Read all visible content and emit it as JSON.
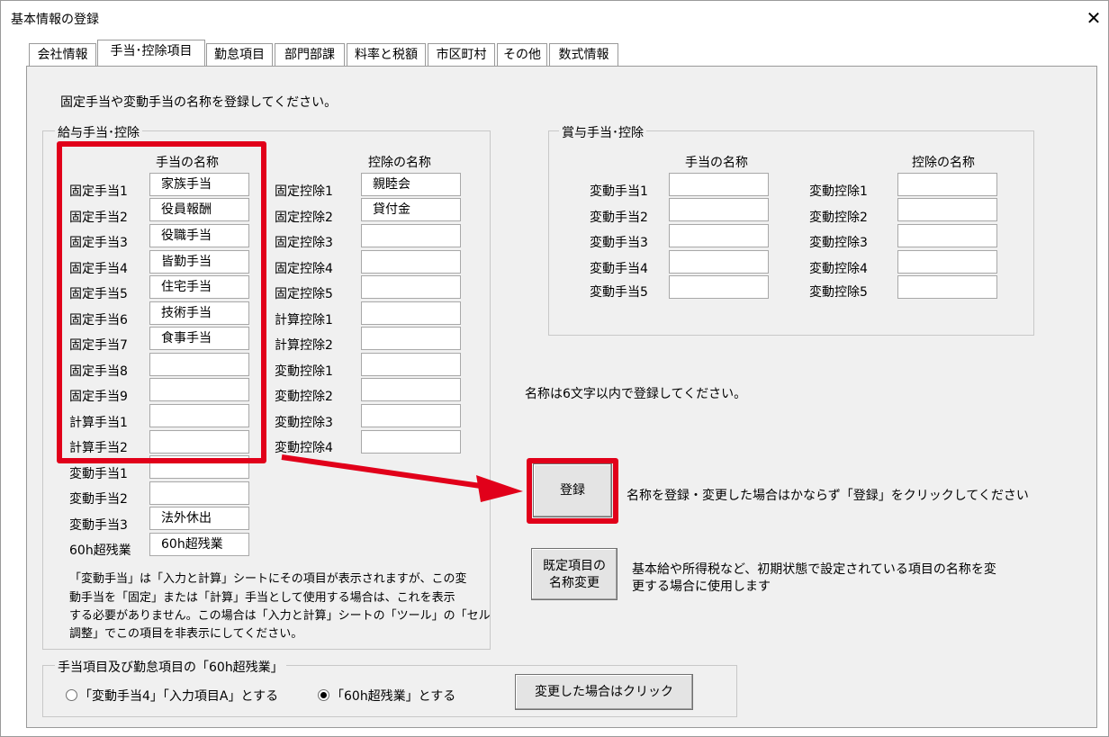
{
  "window": {
    "title": "基本情報の登録",
    "close_label": "✕"
  },
  "tabs": [
    {
      "label": "会社情報"
    },
    {
      "label": "手当･控除項目"
    },
    {
      "label": "勤怠項目"
    },
    {
      "label": "部門部課"
    },
    {
      "label": "料率と税額"
    },
    {
      "label": "市区町村"
    },
    {
      "label": "その他"
    },
    {
      "label": "数式情報"
    }
  ],
  "active_tab": "手当･控除項目",
  "instruction": "固定手当や変動手当の名称を登録してください。",
  "salary_group": {
    "title": "給与手当･控除",
    "allow_header": "手当の名称",
    "deduct_header": "控除の名称",
    "allowances": [
      {
        "label": "固定手当1",
        "value": "家族手当"
      },
      {
        "label": "固定手当2",
        "value": "役員報酬"
      },
      {
        "label": "固定手当3",
        "value": "役職手当"
      },
      {
        "label": "固定手当4",
        "value": "皆勤手当"
      },
      {
        "label": "固定手当5",
        "value": "住宅手当"
      },
      {
        "label": "固定手当6",
        "value": "技術手当"
      },
      {
        "label": "固定手当7",
        "value": "食事手当"
      },
      {
        "label": "固定手当8",
        "value": ""
      },
      {
        "label": "固定手当9",
        "value": ""
      },
      {
        "label": "計算手当1",
        "value": ""
      },
      {
        "label": "計算手当2",
        "value": ""
      },
      {
        "label": "変動手当1",
        "value": ""
      },
      {
        "label": "変動手当2",
        "value": ""
      },
      {
        "label": "変動手当3",
        "value": "法外休出"
      },
      {
        "label": "60h超残業",
        "value": "60h超残業"
      }
    ],
    "deductions": [
      {
        "label": "固定控除1",
        "value": "親睦会"
      },
      {
        "label": "固定控除2",
        "value": "貸付金"
      },
      {
        "label": "固定控除3",
        "value": ""
      },
      {
        "label": "固定控除4",
        "value": ""
      },
      {
        "label": "固定控除5",
        "value": ""
      },
      {
        "label": "計算控除1",
        "value": ""
      },
      {
        "label": "計算控除2",
        "value": ""
      },
      {
        "label": "変動控除1",
        "value": ""
      },
      {
        "label": "変動控除2",
        "value": ""
      },
      {
        "label": "変動控除3",
        "value": ""
      },
      {
        "label": "変動控除4",
        "value": ""
      }
    ],
    "note_lines": [
      "「変動手当」は「入力と計算」シートにその項目が表示されますが、この変",
      "動手当を「固定」または「計算」手当として使用する場合は、これを表示",
      "する必要がありません。この場合は「入力と計算」シートの「ツール」の「セル",
      "調整」でこの項目を非表示にしてください。"
    ]
  },
  "bonus_group": {
    "title": "賞与手当･控除",
    "allow_header": "手当の名称",
    "deduct_header": "控除の名称",
    "allowances": [
      {
        "label": "変動手当1",
        "value": ""
      },
      {
        "label": "変動手当2",
        "value": ""
      },
      {
        "label": "変動手当3",
        "value": ""
      },
      {
        "label": "変動手当4",
        "value": ""
      },
      {
        "label": "変動手当5",
        "value": ""
      }
    ],
    "deductions": [
      {
        "label": "変動控除1",
        "value": ""
      },
      {
        "label": "変動控除2",
        "value": ""
      },
      {
        "label": "変動控除3",
        "value": ""
      },
      {
        "label": "変動控除4",
        "value": ""
      },
      {
        "label": "変動控除5",
        "value": ""
      }
    ]
  },
  "name_limit_note": "名称は6文字以内で登録してください。",
  "register": {
    "label": "登録",
    "note": "名称を登録・変更した場合はかならず「登録」をクリックしてください"
  },
  "rename_defaults": {
    "label_line1": "既定項目の",
    "label_line2": "名称変更",
    "note_line1": "基本給や所得税など、初期状態で設定されている項目の名称を変",
    "note_line2": "更する場合に使用します"
  },
  "overtime_group": {
    "title": "手当項目及び勤怠項目の「60h超残業」",
    "option1": "「変動手当4」「入力項目A」とする",
    "option2": "「60h超残業」とする",
    "selected": "option2",
    "change_button": "変更した場合はクリック"
  },
  "colors": {
    "highlight_red": "#e1001a",
    "panel_bg": "#f0f0f0"
  }
}
